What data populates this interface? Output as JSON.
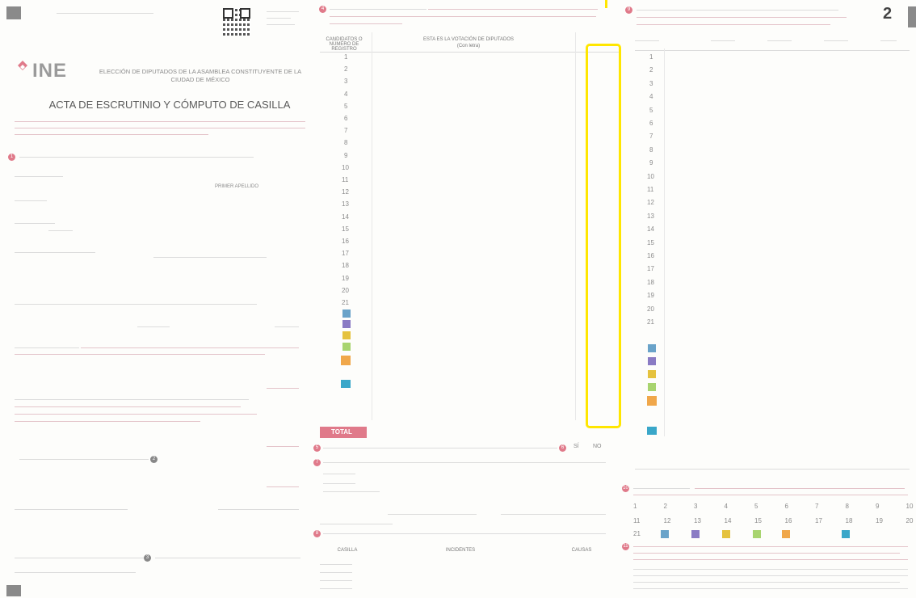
{
  "header": {
    "page_number": "2"
  },
  "left": {
    "brand": "INE",
    "election": "ELECCIÓN DE DIPUTADOS DE LA ASAMBLEA CONSTITUYENTE DE LA CIUDAD DE MÉXICO",
    "title": "ACTA DE ESCRUTINIO Y CÓMPUTO DE CASILLA",
    "field_1": "PRIMER APELLIDO"
  },
  "middle": {
    "header_count": "CANDIDATOS O NÚMERO DE REGISTRO",
    "header_votes": "ESTA ES LA VOTACIÓN DE DIPUTADOS",
    "header_sub": "(Con letra)",
    "rows": [
      "1",
      "2",
      "3",
      "4",
      "5",
      "6",
      "7",
      "8",
      "9",
      "10",
      "11",
      "12",
      "13",
      "14",
      "15",
      "16",
      "17",
      "18",
      "19",
      "20",
      "21"
    ],
    "total_label": "TOTAL",
    "yes_label": "SÍ",
    "no_label": "NO",
    "table_col_1": "CASILLA",
    "table_col_2": "INCIDENTES",
    "table_col_3": "CAUSAS"
  },
  "right": {
    "rows": [
      "1",
      "2",
      "3",
      "4",
      "5",
      "6",
      "7",
      "8",
      "9",
      "10",
      "11",
      "12",
      "13",
      "14",
      "15",
      "16",
      "17",
      "18",
      "19",
      "20",
      "21"
    ],
    "grid_row_1": [
      "1",
      "2",
      "3",
      "4",
      "5",
      "6",
      "7",
      "8",
      "9",
      "10"
    ],
    "grid_row_2": [
      "11",
      "12",
      "13",
      "14",
      "15",
      "16",
      "17",
      "18",
      "19",
      "20"
    ],
    "grid_row_3": [
      "21"
    ]
  },
  "colors": {
    "accent_pink": "#e07a8a",
    "highlight_yellow": "#ffe600",
    "ink_gray": "#8b8b8b"
  }
}
